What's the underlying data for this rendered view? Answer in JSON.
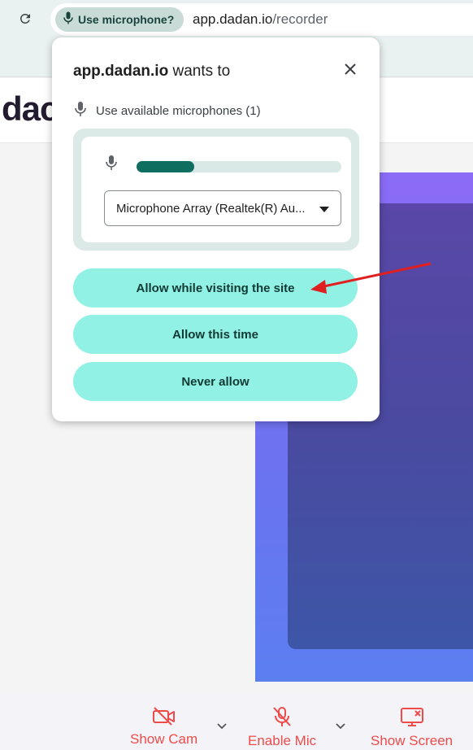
{
  "browser": {
    "permission_chip_label": "Use microphone?",
    "url_host": "app.dadan.io",
    "url_path": "/recorder"
  },
  "page": {
    "logo_text": "dac"
  },
  "popup": {
    "title_site": "app.dadan.io",
    "title_rest": " wants to",
    "mic_permission_text": "Use available microphones (1)",
    "input_level": 0.28,
    "selected_device": "Microphone Array (Realtek(R) Au...",
    "buttons": {
      "allow_while_visiting": "Allow while visiting the site",
      "allow_this_time": "Allow this time",
      "never_allow": "Never allow"
    }
  },
  "toolbar": {
    "show_cam": "Show Cam",
    "enable_mic": "Enable Mic",
    "show_screen": "Show Screen"
  },
  "colors": {
    "accent_teal": "#92f1e5",
    "level_fill": "#0e6e60",
    "tool_red": "#ef4b4b",
    "annotation_arrow": "#e02020"
  }
}
